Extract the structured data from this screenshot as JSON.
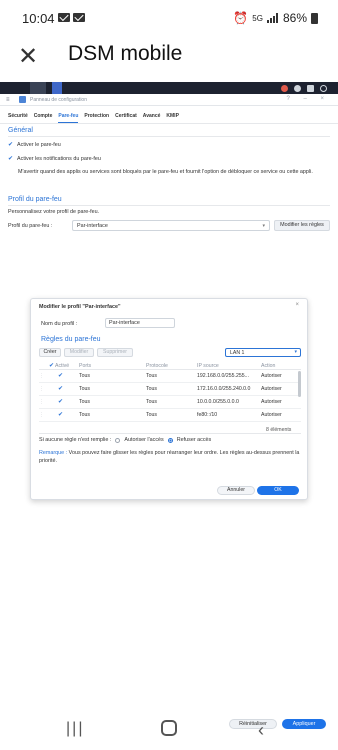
{
  "status_bar": {
    "time": "10:04",
    "network": "5G",
    "battery": "86%",
    "icons": [
      "mail-icon",
      "mail-icon",
      "alarm-icon",
      "signal-icon",
      "battery-icon"
    ]
  },
  "app_header": {
    "close_glyph": "✕",
    "title": "DSM mobile"
  },
  "control_panel": {
    "window_title": "Panneau de configuration",
    "tabs": [
      {
        "label": "Sécurité"
      },
      {
        "label": "Compte"
      },
      {
        "label": "Pare-feu",
        "active": true
      },
      {
        "label": "Protection"
      },
      {
        "label": "Certificat"
      },
      {
        "label": "Avancé"
      },
      {
        "label": "KMIP"
      }
    ],
    "general": {
      "title": "Général",
      "enable_firewall": "Activer le pare-feu",
      "enable_notifications": "Activer les notifications du pare-feu",
      "notification_note": "M'avertir quand des applis ou services sont bloqués par le pare-feu et fournit l'option de débloquer ce service ou cette appli."
    },
    "profile": {
      "title": "Profil du pare-feu",
      "description": "Personnalisez votre profil de pare-feu.",
      "label": "Profil du pare-feu :",
      "selected": "Par-interface",
      "modify_button": "Modifier les règles"
    }
  },
  "modal": {
    "title": "Modifier le profil \"Par-interface\"",
    "name_label": "Nom du profil :",
    "name_value": "Par-interface",
    "rules_title": "Règles du pare-feu",
    "buttons": {
      "create": "Créer",
      "modify": "Modifier",
      "delete": "Supprimer"
    },
    "interface_selected": "LAN 1",
    "columns": [
      "Activé",
      "Ports",
      "Protocole",
      "IP source",
      "Action"
    ],
    "rows": [
      {
        "ports": "Tous",
        "protocol": "Tous",
        "source_ip": "192.168.0.0/255.255...",
        "action": "Autoriser"
      },
      {
        "ports": "Tous",
        "protocol": "Tous",
        "source_ip": "172.16.0.0/255.240.0.0",
        "action": "Autoriser"
      },
      {
        "ports": "Tous",
        "protocol": "Tous",
        "source_ip": "10.0.0.0/255.0.0.0",
        "action": "Autoriser"
      },
      {
        "ports": "Tous",
        "protocol": "Tous",
        "source_ip": "fe80::/10",
        "action": "Autoriser"
      }
    ],
    "item_count": "8 éléments",
    "no_rule_label": "Si aucune règle n'est remplie :",
    "allow_access": "Autoriser l'accès",
    "deny_access": "Refuser accès",
    "remark_label": "Remarque :",
    "remark_text": "Vous pouvez faire glisser les règles pour réarranger leur ordre. Les règles au-dessus prennent la priorité.",
    "cancel": "Annuler",
    "ok": "OK"
  },
  "footer": {
    "reset": "Réinitialiser",
    "apply": "Appliquer"
  },
  "colors": {
    "accent": "#2c74d6",
    "primary_button": "#1e73e8",
    "dsm_bar": "#1d2230"
  }
}
